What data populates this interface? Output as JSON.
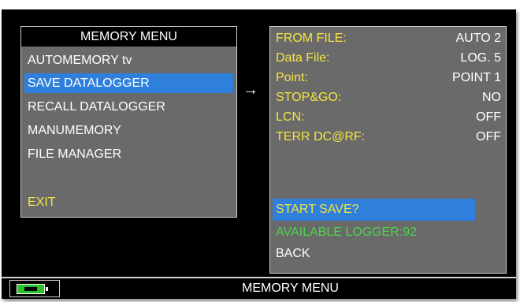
{
  "left_menu": {
    "title": "MEMORY MENU",
    "items": [
      {
        "label": "AUTOMEMORY tv"
      },
      {
        "label": "SAVE DATALOGGER"
      },
      {
        "label": "RECALL DATALOGGER"
      },
      {
        "label": "MANUMEMORY"
      },
      {
        "label": "FILE MANAGER"
      }
    ],
    "exit_label": "EXIT"
  },
  "arrow": "→",
  "right_panel": {
    "fields": [
      {
        "label": "FROM FILE:",
        "value": "AUTO 2"
      },
      {
        "label": "Data File:",
        "value": "LOG. 5"
      },
      {
        "label": "Point:",
        "value": "POINT 1"
      },
      {
        "label": "STOP&GO:",
        "value": "NO"
      },
      {
        "label": "LCN:",
        "value": "OFF"
      },
      {
        "label": "TERR DC@RF:",
        "value": "OFF"
      }
    ],
    "start_save": "START SAVE?",
    "available_logger": "AVAILABLE LOGGER:92",
    "back": "BACK"
  },
  "status_bar": {
    "title": "MEMORY MENU",
    "battery_icon": "battery-charging-icon"
  },
  "colors": {
    "background": "#000000",
    "panel": "#6a6a6a",
    "selection": "#2f7fdc",
    "label_yellow": "#f4e542",
    "available_green": "#4cd44c"
  }
}
